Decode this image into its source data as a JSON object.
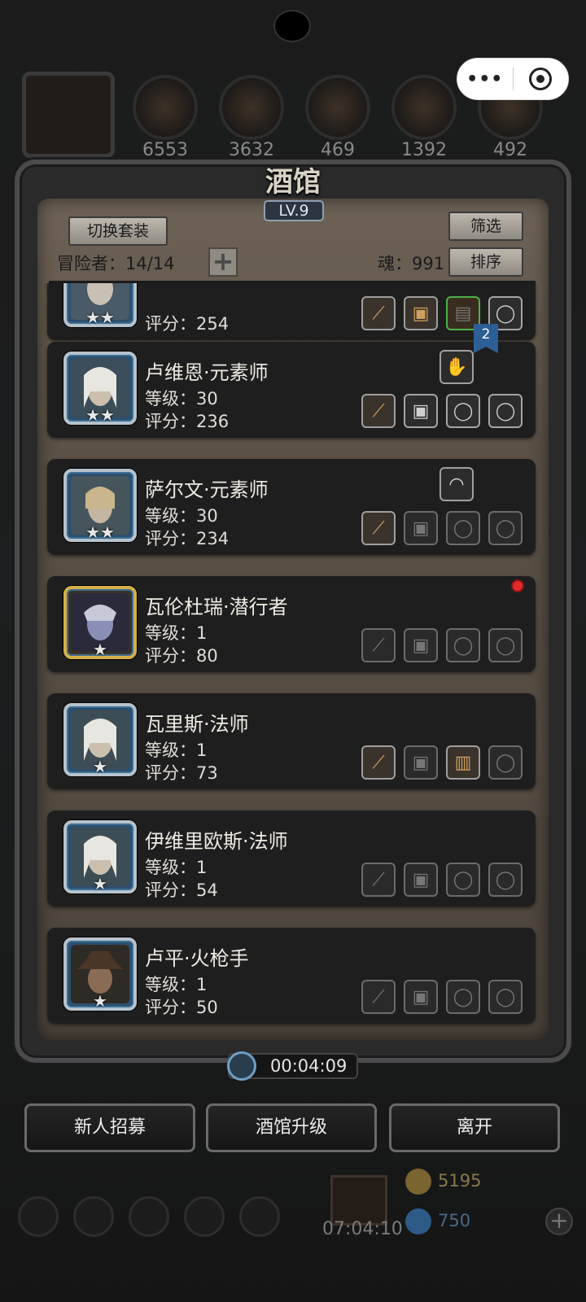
{
  "resources": [
    {
      "name": "meat",
      "value": "6553"
    },
    {
      "name": "wood",
      "value": "3632"
    },
    {
      "name": "iron",
      "value": "469"
    },
    {
      "name": "crystal",
      "value": "1392"
    },
    {
      "name": "anvil",
      "value": "492"
    }
  ],
  "tavern": {
    "title": "酒馆",
    "level": "LV.9"
  },
  "toolbar": {
    "switch_set": "切换套装",
    "filter": "筛选",
    "sort": "排序",
    "adventurers": "冒险者：14/14",
    "soul": "魂：991",
    "add": "+"
  },
  "badge_count": "2",
  "heroes": [
    {
      "name": "",
      "level": "",
      "score": "评分：254",
      "stars": "★★",
      "slots": [
        "staff",
        "armor",
        "wood",
        "ring"
      ]
    },
    {
      "name": "卢维恩·元素师",
      "level": "等级：30",
      "score": "评分：236",
      "stars": "★★",
      "extra": "glove",
      "slots": [
        "staff",
        "armor",
        "ring",
        "ring"
      ]
    },
    {
      "name": "萨尔文·元素师",
      "level": "等级：30",
      "score": "评分：234",
      "stars": "★★",
      "extra": "hood",
      "slots": [
        "staff",
        "empty",
        "empty",
        "empty"
      ]
    },
    {
      "name": "瓦伦杜瑞·潜行者",
      "level": "等级：1",
      "score": "评分：80",
      "stars": "★",
      "slots": [
        "empty",
        "empty",
        "empty",
        "empty"
      ]
    },
    {
      "name": "瓦里斯·法师",
      "level": "等级：1",
      "score": "评分：73",
      "stars": "★",
      "slots": [
        "staff",
        "empty",
        "chest",
        "empty"
      ]
    },
    {
      "name": "伊维里欧斯·法师",
      "level": "等级：1",
      "score": "评分：54",
      "stars": "★",
      "slots": [
        "empty",
        "empty",
        "empty",
        "empty"
      ]
    },
    {
      "name": "卢平·火枪手",
      "level": "等级：1",
      "score": "评分：50",
      "stars": "★",
      "slots": [
        "empty",
        "empty",
        "empty",
        "empty"
      ]
    }
  ],
  "timer": "00:04:09",
  "actions": {
    "recruit": "新人招募",
    "upgrade": "酒馆升级",
    "leave": "离开"
  },
  "bottom": {
    "time": "07:04:10",
    "gold": "5195",
    "gems": "750"
  },
  "capsule": {
    "more": "•••"
  }
}
